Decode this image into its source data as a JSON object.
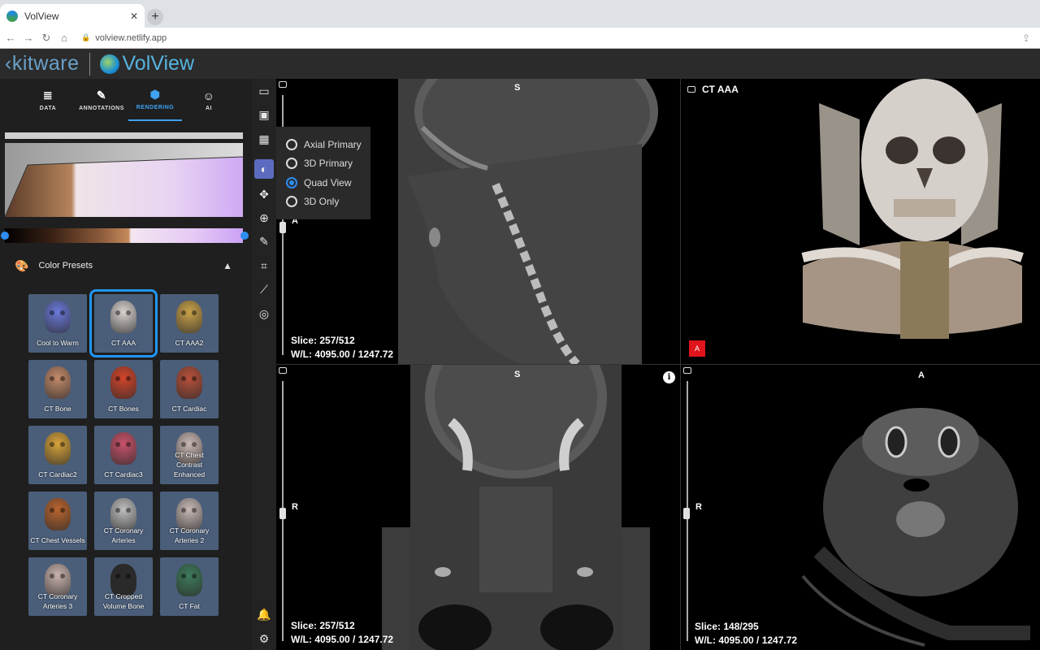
{
  "browser": {
    "tab_title": "VolView",
    "tab_close": "✕",
    "new_tab": "+",
    "url": "volview.netlify.app"
  },
  "app_header": {
    "brand_kitware": "kitware",
    "brand_volview": "VolView"
  },
  "nav_tabs": [
    {
      "label": "DATA",
      "icon": "database-icon"
    },
    {
      "label": "ANNOTATIONS",
      "icon": "pencil-icon"
    },
    {
      "label": "RENDERING",
      "icon": "cube-icon"
    },
    {
      "label": "AI",
      "icon": "robot-icon"
    }
  ],
  "active_tab": "RENDERING",
  "color_presets": {
    "title": "Color Presets",
    "items": [
      {
        "label": "Cool to Warm",
        "color": "#6a78d8"
      },
      {
        "label": "CT AAA",
        "color": "#d8d2cf",
        "selected": true
      },
      {
        "label": "CT AAA2",
        "color": "#c9a14a"
      },
      {
        "label": "CT Bone",
        "color": "#c48a6a"
      },
      {
        "label": "CT Bones",
        "color": "#d4442a"
      },
      {
        "label": "CT Cardiac",
        "color": "#b8503a"
      },
      {
        "label": "CT Cardiac2",
        "color": "#d6a23a"
      },
      {
        "label": "CT Cardiac3",
        "color": "#c8526a"
      },
      {
        "label": "CT Chest Contrast Enhanced",
        "color": "#c9b7b3"
      },
      {
        "label": "CT Chest Vessels",
        "color": "#b8642e"
      },
      {
        "label": "CT Coronary Arteries",
        "color": "#bfbfbf"
      },
      {
        "label": "CT Coronary Arteries 2",
        "color": "#c7b9b5"
      },
      {
        "label": "CT Coronary Arteries 3",
        "color": "#c9b2ac"
      },
      {
        "label": "CT Cropped Volume Bone",
        "color": "#2a2a2a"
      },
      {
        "label": "CT Fat",
        "color": "#3d7a5a"
      }
    ]
  },
  "layout_menu": {
    "options": [
      "Axial Primary",
      "3D Primary",
      "Quad View",
      "3D Only"
    ],
    "selected": "Quad View"
  },
  "viewports": {
    "sagittal": {
      "top_label": "S",
      "left_label": "A",
      "slice": "Slice: 257/512",
      "wl": "W/L: 4095.00 / 1247.72"
    },
    "volume": {
      "title": "CT AAA",
      "orient_marker": "A"
    },
    "coronal": {
      "top_label": "S",
      "left_label": "R",
      "slice": "Slice: 257/512",
      "wl": "W/L: 4095.00 / 1247.72"
    },
    "axial": {
      "top_label": "A",
      "left_label": "R",
      "slice": "Slice: 148/295",
      "wl": "W/L: 4095.00 / 1247.72"
    }
  }
}
